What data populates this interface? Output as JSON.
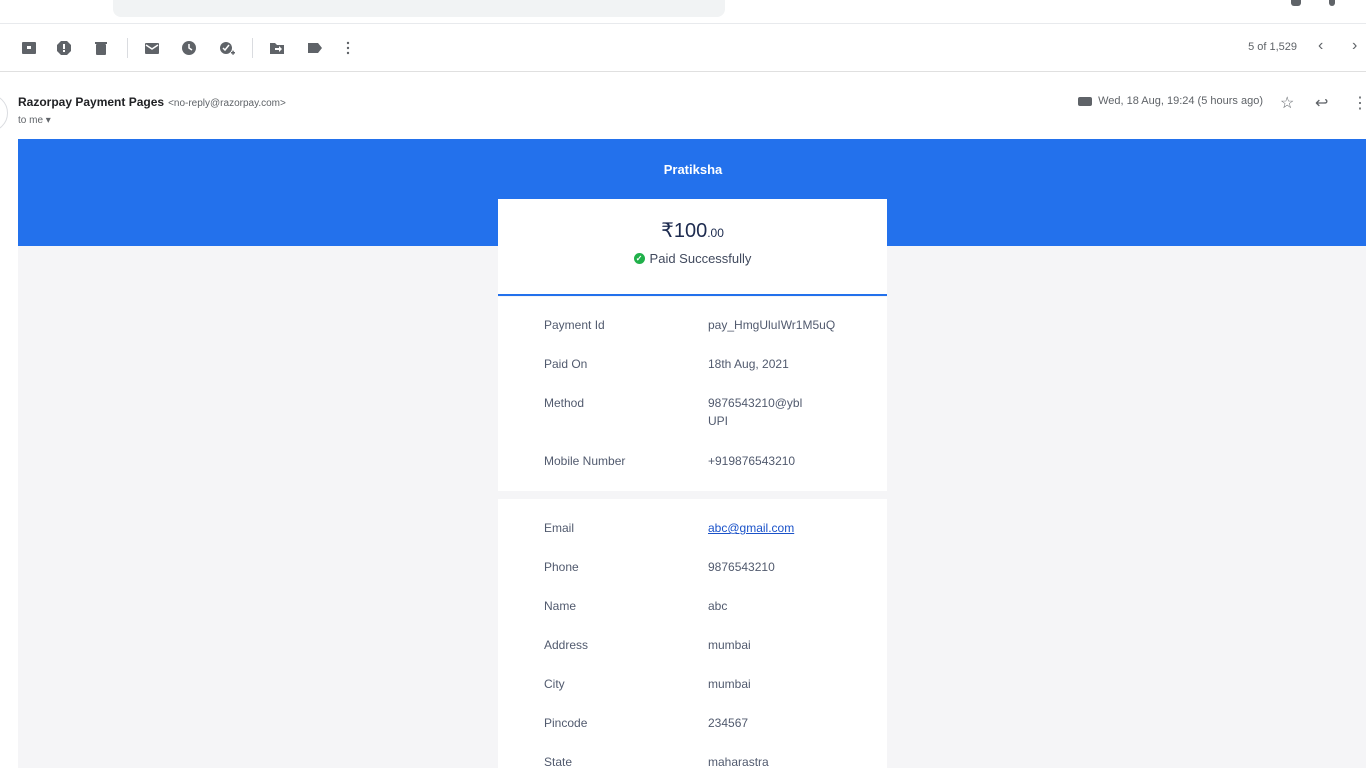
{
  "toolbar": {
    "icons": [
      "archive-icon",
      "report-spam-icon",
      "delete-icon",
      "mark-unread-icon",
      "snooze-icon",
      "add-to-tasks-icon",
      "move-to-icon",
      "labels-icon",
      "more-icon"
    ],
    "pager": "5 of 1,529",
    "prev": "‹",
    "next": "›"
  },
  "email": {
    "sender_name": "Razorpay Payment Pages",
    "sender_email": "<no-reply@razorpay.com>",
    "to_me": "to me ▾",
    "date": "Wed, 18 Aug, 19:24 (5 hours ago)"
  },
  "receipt": {
    "merchant": "Pratiksha",
    "amount_main": "₹100",
    "amount_paise": ".00",
    "status": "Paid Successfully",
    "details": [
      {
        "label": "Payment Id",
        "value": "pay_HmgUluIWr1M5uQ"
      },
      {
        "label": "Paid On",
        "value": "18th Aug, 2021"
      },
      {
        "label": "Method",
        "value": "9876543210@ybl",
        "sub": "UPI"
      },
      {
        "label": "Mobile Number",
        "value": "+919876543210"
      }
    ],
    "customer": [
      {
        "label": "Email",
        "value": "abc@gmail.com"
      },
      {
        "label": "Phone",
        "value": "9876543210"
      },
      {
        "label": "Name",
        "value": "abc"
      },
      {
        "label": "Address",
        "value": "mumbai"
      },
      {
        "label": "City",
        "value": "mumbai"
      },
      {
        "label": "Pincode",
        "value": "234567"
      },
      {
        "label": "State",
        "value": "maharastra"
      }
    ]
  },
  "colors": {
    "brand_blue": "#2371ec",
    "success_green": "#20b04a",
    "link_blue": "#1a52c9"
  }
}
